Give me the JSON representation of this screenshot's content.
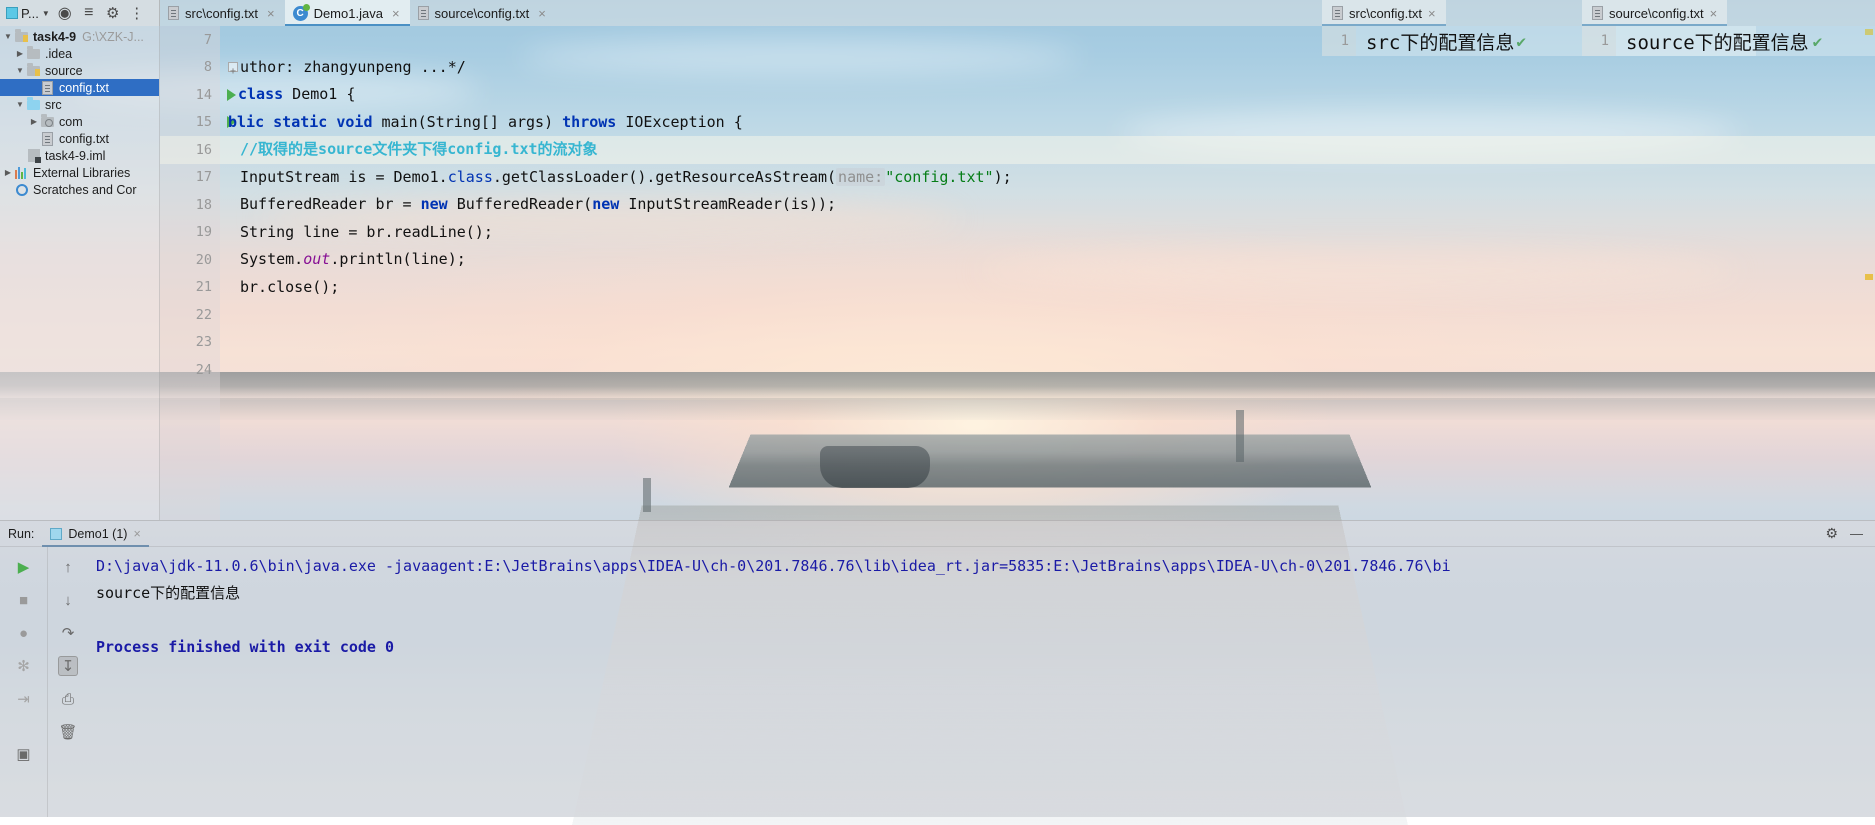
{
  "toolbar": {
    "project_label": "P...",
    "icons": [
      "project-dropdown",
      "locate-icon",
      "collapse-all-icon",
      "settings-gear-icon",
      "more-icon"
    ]
  },
  "editor_tabs": [
    {
      "label": "src\\config.txt",
      "icon": "text-file-icon",
      "active": false,
      "close": "×"
    },
    {
      "label": "Demo1.java",
      "icon": "java-class-icon",
      "active": true,
      "close": "×"
    },
    {
      "label": "source\\config.txt",
      "icon": "text-file-icon",
      "active": false,
      "close": "×"
    }
  ],
  "project_tree": [
    {
      "arrow": "▼",
      "label": "task4-9",
      "path": "G:\\XZK-J...",
      "icon": "module-folder-icon",
      "indent": 0,
      "bold": true,
      "selected": false
    },
    {
      "arrow": "▶",
      "label": ".idea",
      "path": "",
      "icon": "folder-icon",
      "indent": 1,
      "bold": false,
      "selected": false
    },
    {
      "arrow": "▼",
      "label": "source",
      "path": "",
      "icon": "resource-folder-icon",
      "indent": 1,
      "bold": false,
      "selected": false
    },
    {
      "arrow": "",
      "label": "config.txt",
      "path": "",
      "icon": "text-file-icon",
      "indent": 2,
      "bold": false,
      "selected": true
    },
    {
      "arrow": "▼",
      "label": "src",
      "path": "",
      "icon": "source-folder-icon",
      "indent": 1,
      "bold": false,
      "selected": false
    },
    {
      "arrow": "▶",
      "label": "com",
      "path": "",
      "icon": "package-folder-icon",
      "indent": 2,
      "bold": false,
      "selected": false
    },
    {
      "arrow": "",
      "label": "config.txt",
      "path": "",
      "icon": "text-file-icon",
      "indent": 2,
      "bold": false,
      "selected": false
    },
    {
      "arrow": "",
      "label": "task4-9.iml",
      "path": "",
      "icon": "module-file-icon",
      "indent": 1,
      "bold": false,
      "selected": false
    },
    {
      "arrow": "▶",
      "label": "External Libraries",
      "path": "",
      "icon": "libraries-icon",
      "indent": 0,
      "bold": false,
      "selected": false
    },
    {
      "arrow": "",
      "label": "Scratches and Cor",
      "path": "",
      "icon": "scratches-icon",
      "indent": 0,
      "bold": false,
      "selected": false
    }
  ],
  "gutter_lines": [
    {
      "n": "7",
      "run": false
    },
    {
      "n": "8",
      "run": false
    },
    {
      "n": "14",
      "run": true
    },
    {
      "n": "15",
      "run": true
    },
    {
      "n": "16",
      "run": false
    },
    {
      "n": "17",
      "run": false
    },
    {
      "n": "18",
      "run": false
    },
    {
      "n": "19",
      "run": false
    },
    {
      "n": "20",
      "run": false
    },
    {
      "n": "21",
      "run": false
    },
    {
      "n": "22",
      "run": false
    },
    {
      "n": "23",
      "run": false
    },
    {
      "n": "24",
      "run": false
    }
  ],
  "code": {
    "line7": "",
    "line8_doc": "uthor: zhangyunpeng ...*/",
    "line14_kw": "class",
    "line14_rest": " Demo1 {",
    "line15_a": "blic",
    "line15_b": " static",
    "line15_c": " void",
    "line15_d": " main(String[] args) ",
    "line15_e": "throws",
    "line15_f": " IOException {",
    "line16_comment": "//取得的是source文件夹下得config.txt的流对象",
    "line17_a": "InputStream is = Demo1.",
    "line17_class": "class",
    "line17_b": ".getClassLoader().getResourceAsStream(",
    "line17_hint": "name:",
    "line17_str": "\"config.txt\"",
    "line17_c": ");",
    "line18_a": "BufferedReader br = ",
    "line18_new1": "new",
    "line18_b": " BufferedReader(",
    "line18_new2": "new",
    "line18_c": " InputStreamReader(is));",
    "line19": "String line = br.readLine();",
    "line20_a": "System.",
    "line20_out": "out",
    "line20_b": ".println(line);",
    "line21": "br.close();",
    "line22": "",
    "line23": "",
    "line24": ""
  },
  "preview_panes": [
    {
      "tab_label": "src\\config.txt",
      "tab_icon": "text-file-icon",
      "line_number": "1",
      "content": "src下的配置信息",
      "status_icon": "✔",
      "status_color": "#59a869"
    },
    {
      "tab_label": "source\\config.txt",
      "tab_icon": "text-file-icon",
      "line_number": "1",
      "content": "source下的配置信息",
      "status_icon": "✔",
      "status_color": "#59a869"
    }
  ],
  "run_window": {
    "label": "Run:",
    "tab_label": "Demo1 (1)",
    "tab_close": "×",
    "settings_icon": "gear-icon",
    "minimize_icon": "—",
    "left_tools": [
      "rerun-play-icon",
      "stop-icon",
      "filter-icon",
      "export-icon",
      "trash-icon"
    ],
    "right_tools": [
      "scroll-up-icon",
      "scroll-down-icon",
      "soft-wrap-icon",
      "scroll-to-end-icon",
      "print-icon",
      "clear-all-icon"
    ],
    "console_lines": [
      {
        "text": "D:\\java\\jdk-11.0.6\\bin\\java.exe -javaagent:E:\\JetBrains\\apps\\IDEA-U\\ch-0\\201.7846.76\\lib\\idea_rt.jar=5835:E:\\JetBrains\\apps\\IDEA-U\\ch-0\\201.7846.76\\bi",
        "kind": "cmd"
      },
      {
        "text": "source下的配置信息",
        "kind": "out"
      },
      {
        "text": "",
        "kind": "out"
      },
      {
        "text": "Process finished with exit code 0",
        "kind": "fin"
      }
    ]
  },
  "colors": {
    "accent_tab": "#4a90c4",
    "selection_blue": "#2f6ec4",
    "run_green": "#4caf50",
    "comment_cyan": "#37b6d1",
    "keyword_blue": "#0033b3",
    "string_green": "#067d17",
    "ok_green": "#59a869"
  }
}
